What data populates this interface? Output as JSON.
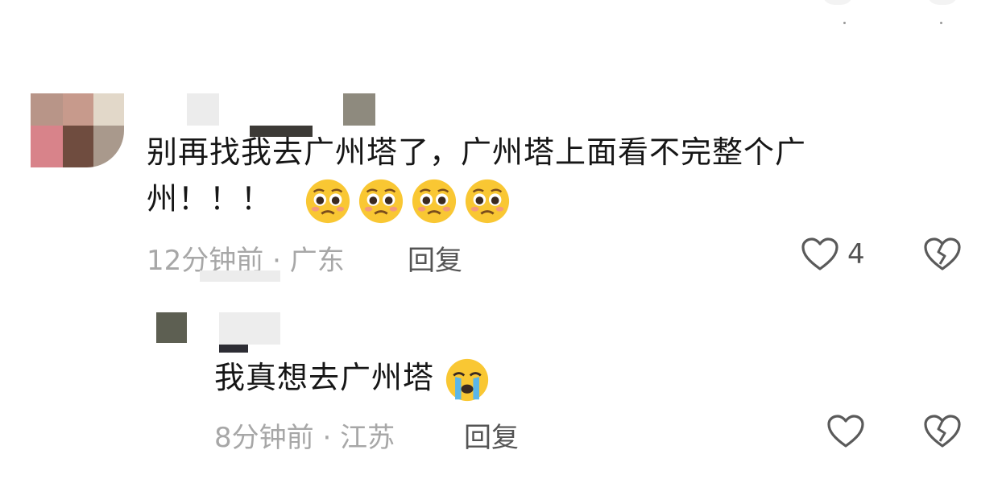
{
  "comments": [
    {
      "text": "别再找我去广州塔了，广州塔上面看不完整个广州！！！",
      "text_line1": "别再找我去广州塔了，广州塔上面看不完整个广",
      "text_line2": "州！！！",
      "emojis": [
        "pleading-face-icon",
        "pleading-face-icon",
        "pleading-face-icon",
        "pleading-face-icon"
      ],
      "time": "12分钟前",
      "separator": "·",
      "location": "广东",
      "reply_label": "回复",
      "like_count": "4"
    }
  ],
  "replies": [
    {
      "text": "我真想去广州塔",
      "emoji": "crying-face-icon",
      "time": "8分钟前",
      "separator": "·",
      "location": "江苏",
      "reply_label": "回复",
      "like_count": ""
    }
  ],
  "colors": {
    "text": "#161616",
    "meta": "#a7a7a7",
    "action": "#545454",
    "emoji_yellow": "#f9c733"
  }
}
